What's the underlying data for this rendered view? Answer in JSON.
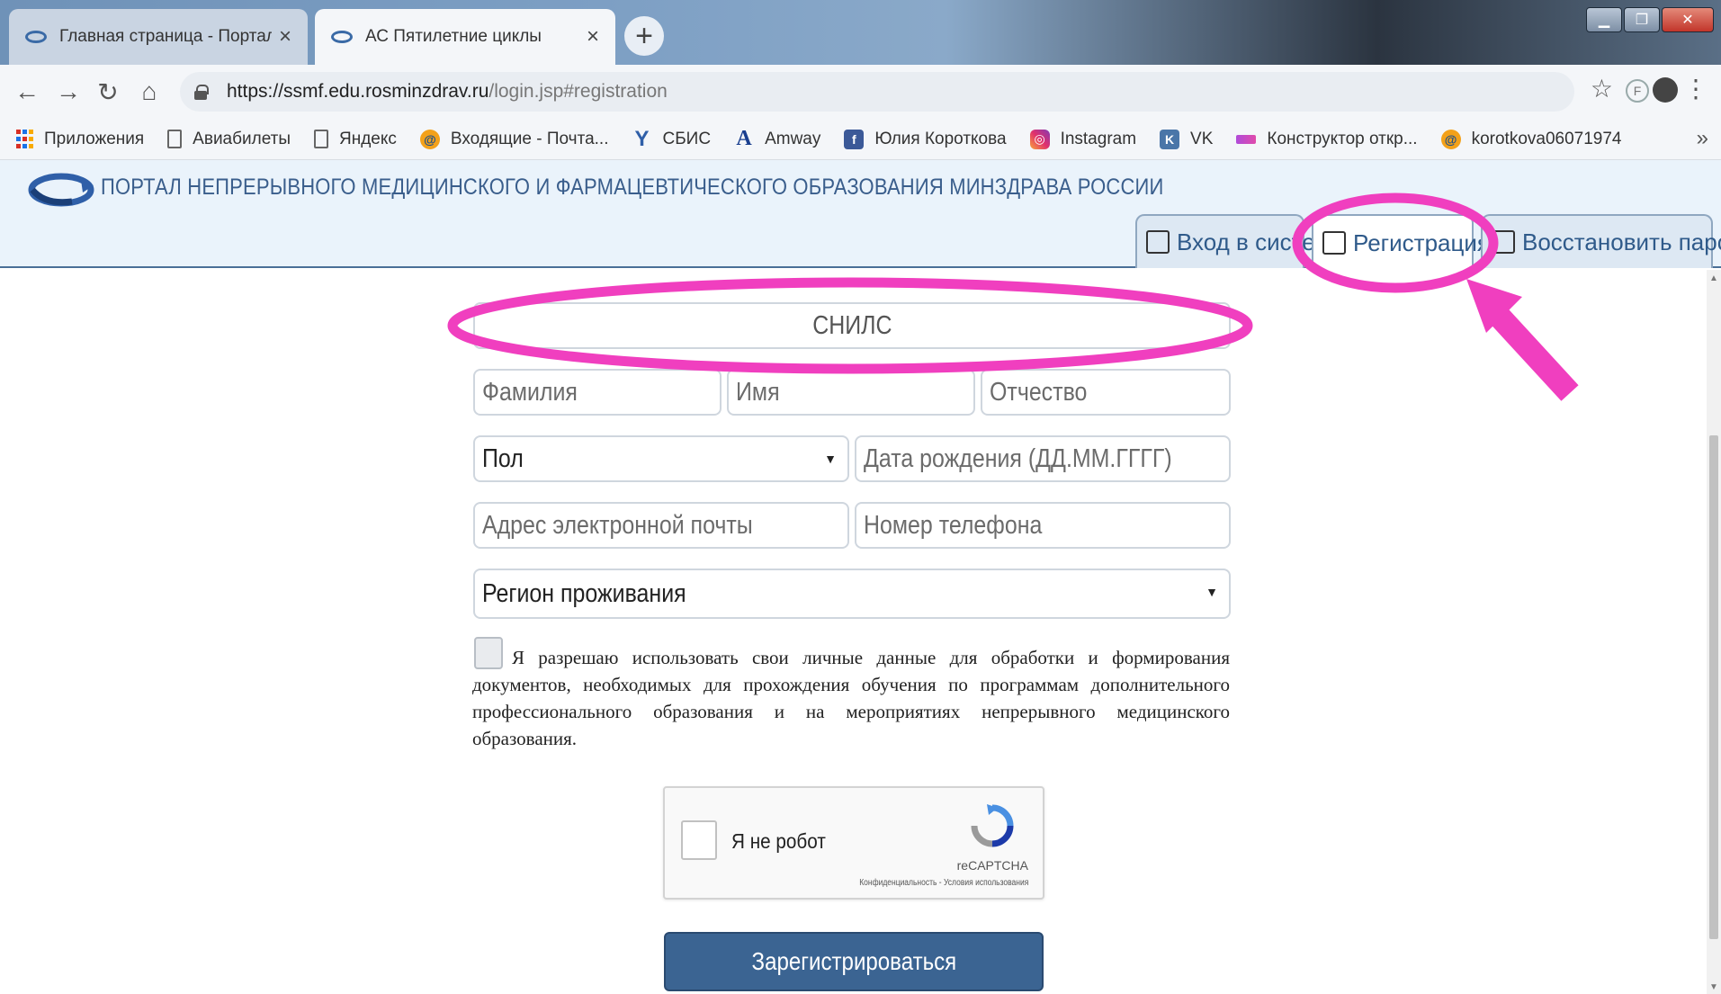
{
  "browser": {
    "tabs": [
      {
        "title": "Главная страница - Портал неп",
        "active": false
      },
      {
        "title": "АС Пятилетние циклы",
        "active": true
      }
    ],
    "new_tab": "+",
    "url_host": "https://ssmf.edu.rosminzdrav.ru",
    "url_path": "/login.jsp#registration",
    "bookmarks": [
      {
        "label": "Приложения",
        "icon": "apps-icon"
      },
      {
        "label": "Авиабилеты",
        "icon": "page-icon"
      },
      {
        "label": "Яндекс",
        "icon": "page-icon"
      },
      {
        "label": "Входящие - Почта...",
        "icon": "mail-icon"
      },
      {
        "label": "СБИС",
        "icon": "sbis-icon"
      },
      {
        "label": "Amway",
        "icon": "amway-icon"
      },
      {
        "label": "Юлия Короткова",
        "icon": "facebook-icon"
      },
      {
        "label": "Instagram",
        "icon": "instagram-icon"
      },
      {
        "label": "VK",
        "icon": "vk-icon"
      },
      {
        "label": "Конструктор откр...",
        "icon": "konstruktor-icon"
      },
      {
        "label": "korotkova06071974",
        "icon": "mail-icon"
      }
    ],
    "bookmarks_more": "»"
  },
  "site": {
    "title": "ПОРТАЛ НЕПРЕРЫВНОГО МЕДИЦИНСКОГО И ФАРМАЦЕВТИЧЕСКОГО ОБРАЗОВАНИЯ МИНЗДРАВА РОССИИ",
    "tabs": {
      "login": "Вход в систему",
      "register": "Регистрация",
      "restore": "Восстановить пароль"
    }
  },
  "form": {
    "snils": "СНИЛС",
    "lastname": "Фамилия",
    "firstname": "Имя",
    "middlename": "Отчество",
    "gender": "Пол",
    "birthdate": "Дата рождения (ДД.ММ.ГГГГ)",
    "email": "Адрес электронной почты",
    "phone": "Номер телефона",
    "region": "Регион проживания",
    "consent": "Я разрешаю использовать свои личные данные для обработки и формирования документов, необходимых для прохождения обучения по программам дополнительного профессионального образования и на мероприятиях непрерывного медицинского образования.",
    "captcha_label": "Я не робот",
    "captcha_brand": "reCAPTCHA",
    "captcha_links": "Конфиденциальность - Условия использования",
    "submit": "Зарегистрироваться"
  },
  "colors": {
    "annotation": "#f03fbf",
    "header_text": "#3a5e8c",
    "submit_bg": "#3b6492"
  }
}
